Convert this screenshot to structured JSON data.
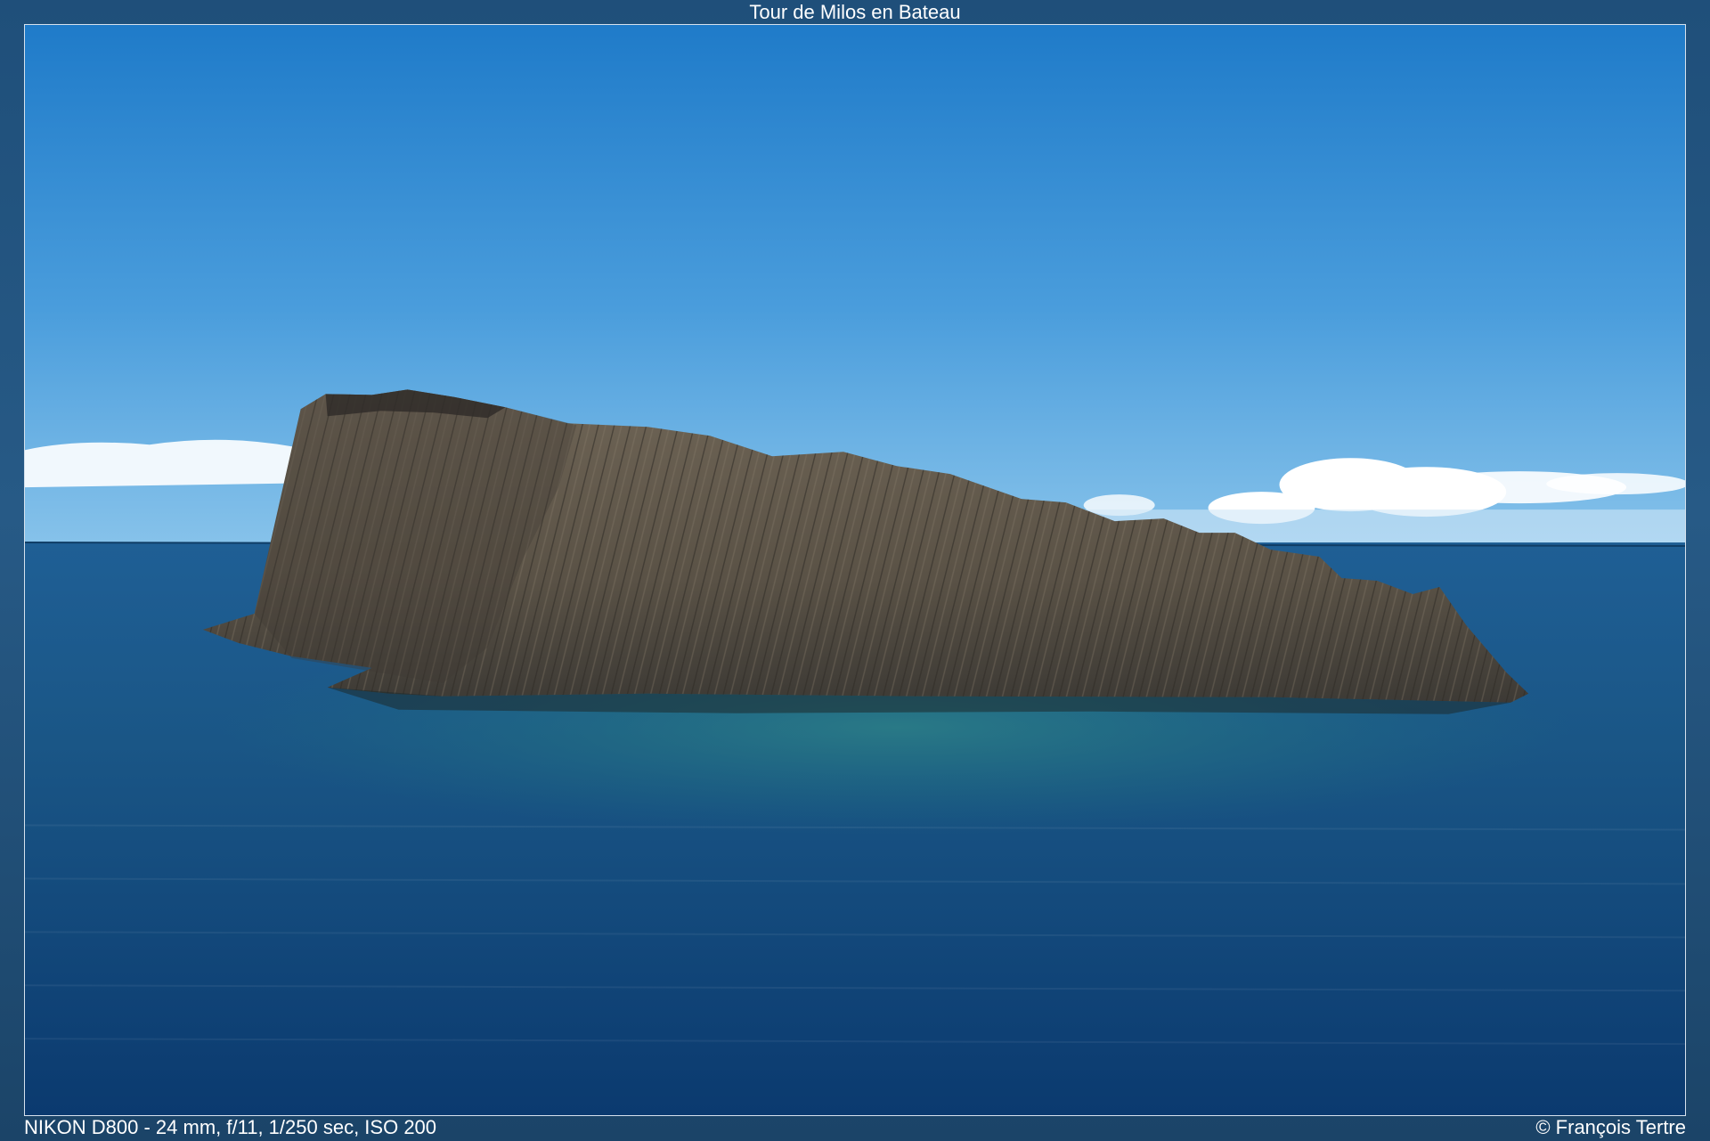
{
  "gallery": {
    "title": "Tour de Milos en Bateau",
    "exif": "NIKON D800 - 24 mm, f/11, 1/250 sec, ISO 200",
    "copyright": "© François Tertre"
  },
  "colors": {
    "frame": "#1f4a70",
    "sky_top": "#1f7bc9",
    "sky_horizon": "#86c2ea",
    "sea_top": "#1f5f95",
    "sea_deep": "#0b3a6f",
    "shallow_water": "#1f6f7f",
    "rock": "#5f564b"
  }
}
